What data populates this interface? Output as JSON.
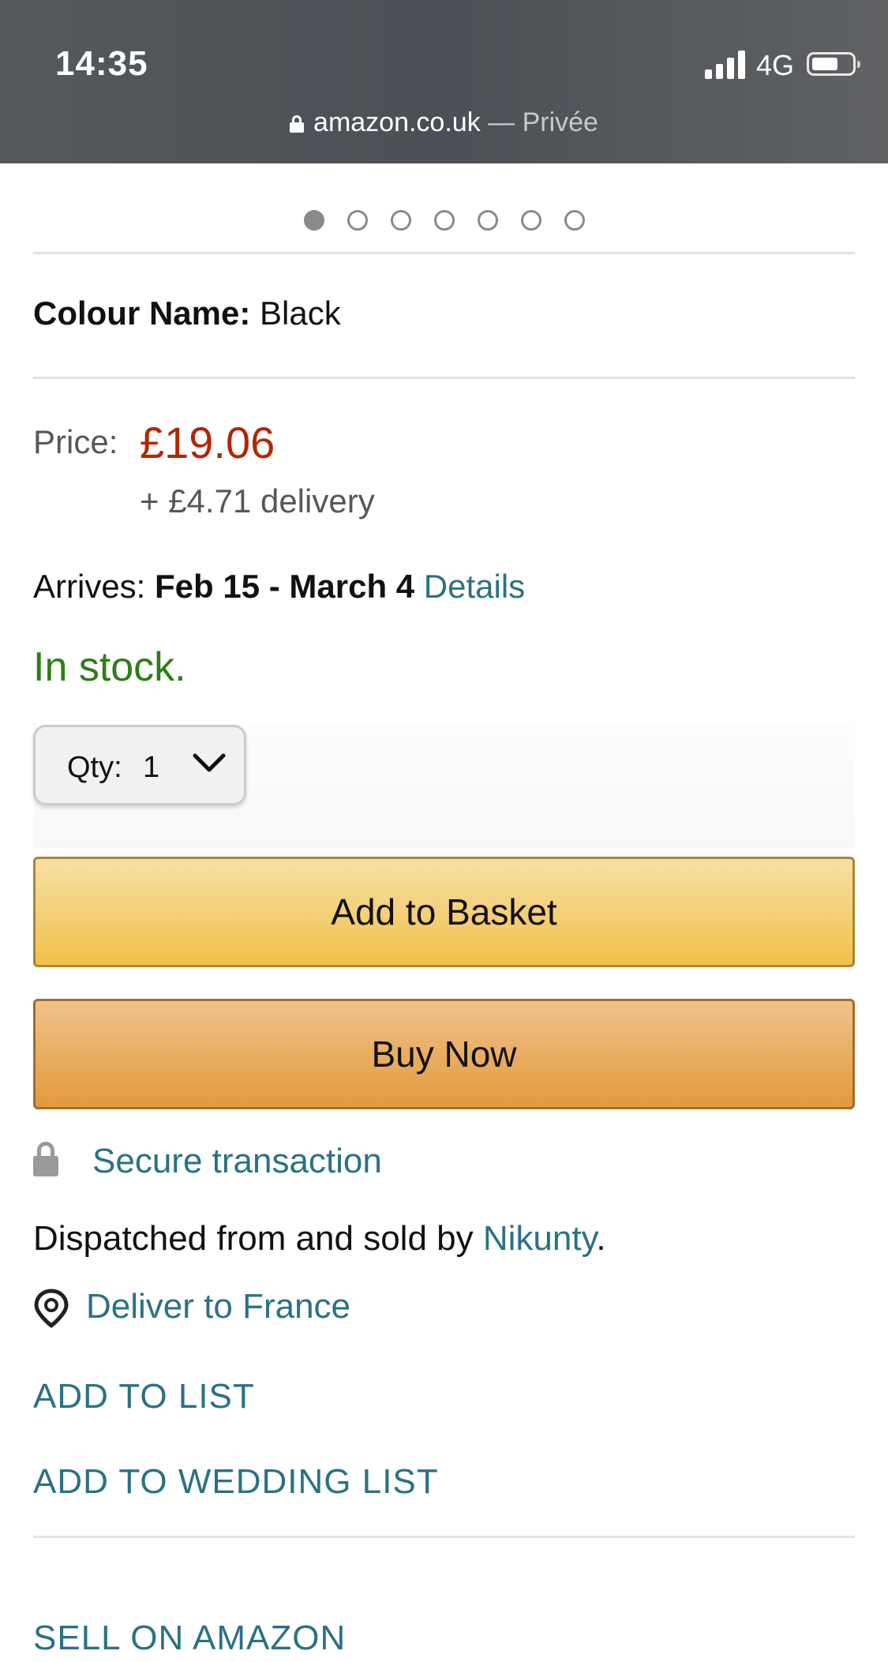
{
  "status_bar": {
    "time": "14:35",
    "network": "4G",
    "url_domain": "amazon.co.uk",
    "url_mode": " — Privée",
    "icons": [
      "signal-icon",
      "battery-icon",
      "lock-icon"
    ]
  },
  "carousel": {
    "count": 7,
    "active_index": 0
  },
  "colour": {
    "label": "Colour Name:",
    "value": " Black"
  },
  "price": {
    "label": "Price:",
    "value": "£19.06",
    "delivery": "+ £4.71 delivery"
  },
  "arrives": {
    "label": "Arrives: ",
    "dates": "Feb 15 - March 4",
    "details_link": "Details"
  },
  "stock": "In stock.",
  "quantity": {
    "label": "Qty:",
    "value": "1",
    "icon": "chevron-down-icon"
  },
  "buttons": {
    "add_to_basket": "Add to Basket",
    "buy_now": "Buy Now"
  },
  "secure": {
    "text": "Secure transaction",
    "icon": "lock-icon"
  },
  "seller": {
    "prefix": "Dispatched from and sold by ",
    "name": "Nikunty",
    "suffix": "."
  },
  "deliver_to": {
    "text": "Deliver to France",
    "icon": "location-pin-icon"
  },
  "links": {
    "add_to_list": "ADD TO LIST",
    "add_to_wedding_list": "ADD TO WEDDING LIST",
    "sell_on_amazon": "SELL ON AMAZON"
  },
  "colors": {
    "price": "#b12704",
    "in_stock": "#2e7d17",
    "link": "#2a7283",
    "basket_button": "#f0c14b",
    "buy_button": "#e29a3c"
  }
}
